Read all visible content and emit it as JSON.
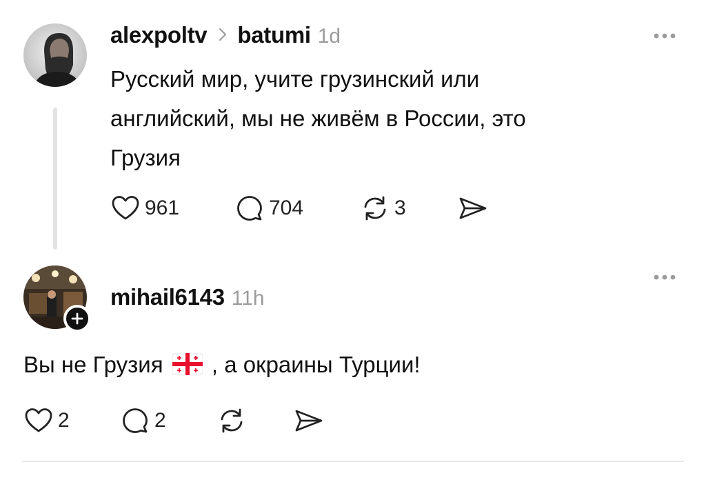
{
  "posts": [
    {
      "username": "alexpoltv",
      "community": "batumi",
      "time": "1d",
      "text_lines": [
        "Русский мир, учите грузинский или",
        "английский, мы не живём в России, это",
        "Грузия"
      ],
      "likes": "961",
      "replies": "704",
      "reposts": "3"
    },
    {
      "username": "mihail6143",
      "time": "11h",
      "text_before_flag": "Вы не Грузия",
      "flag_icon": "georgia-flag-icon",
      "text_after_flag": ", а окраины Турции!",
      "likes": "2",
      "replies": "2"
    }
  ],
  "colors": {
    "text": "#111111",
    "muted": "#9b9b9b",
    "thread_line": "#e3e3e3",
    "georgia_red": "#e8112d"
  }
}
